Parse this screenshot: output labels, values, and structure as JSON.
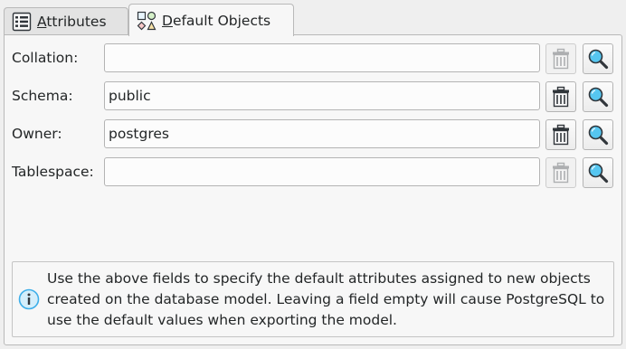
{
  "tabs": [
    {
      "label_pre": "",
      "label_mnemonic": "A",
      "label_post": "ttributes",
      "icon": "attributes-list-icon",
      "active": false
    },
    {
      "label_pre": "",
      "label_mnemonic": "D",
      "label_post": "efault Objects",
      "icon": "default-objects-icon",
      "active": true
    }
  ],
  "fields": [
    {
      "label": "Collation:",
      "value": "",
      "delete_enabled": false
    },
    {
      "label": "Schema:",
      "value": "public",
      "delete_enabled": true
    },
    {
      "label": "Owner:",
      "value": "postgres",
      "delete_enabled": true
    },
    {
      "label": "Tablespace:",
      "value": "",
      "delete_enabled": false
    }
  ],
  "icons": {
    "delete": "trash-icon",
    "find": "magnifier-icon",
    "info": "info-icon"
  },
  "info": {
    "text": "Use the above fields to specify the default attributes assigned to new objects created on the database model. Leaving a field empty will cause PostgreSQL to use the default values when exporting the model."
  },
  "colors": {
    "info_icon": "#3daee9",
    "magnifier_lens": "#56c6f0"
  }
}
